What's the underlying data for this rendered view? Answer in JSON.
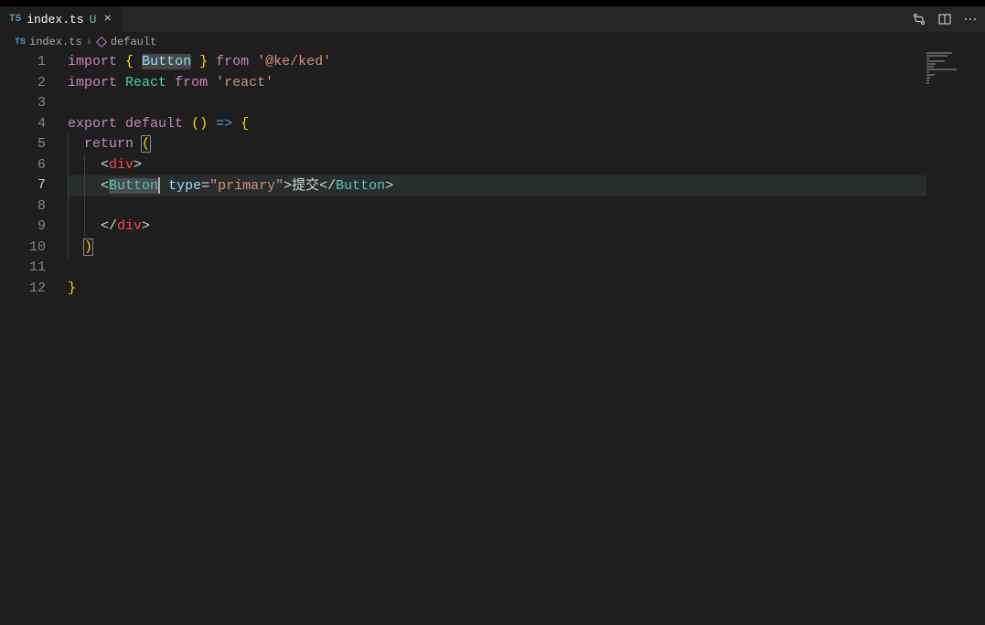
{
  "tab": {
    "filename": "index.ts",
    "status": "U",
    "icon": "TS"
  },
  "breadcrumb": {
    "file_icon": "TS",
    "file": "index.ts",
    "symbol": "default"
  },
  "line_numbers": [
    "1",
    "2",
    "3",
    "4",
    "5",
    "6",
    "7",
    "8",
    "9",
    "10",
    "11",
    "12"
  ],
  "active_line": 7,
  "code": {
    "l1": {
      "import": "import",
      "lbrace": "{",
      "button": "Button",
      "rbrace": "}",
      "from": "from",
      "pkg": "'@ke/ked'"
    },
    "l2": {
      "import": "import",
      "react": "React",
      "from": "from",
      "pkg": "'react'"
    },
    "l4": {
      "export": "export",
      "default": "default",
      "parens": "()",
      "arrow": "=>",
      "lbrace": "{"
    },
    "l5": {
      "return": "return",
      "lparen": "("
    },
    "l6": {
      "lt": "<",
      "div": "div",
      "gt": ">"
    },
    "l7": {
      "lt": "<",
      "button": "Button",
      "space": " ",
      "attr": "type",
      "eq": "=",
      "val": "\"primary\"",
      "gt": ">",
      "text": "提交",
      "lt2": "</",
      "button2": "Button",
      "gt2": ">"
    },
    "l9": {
      "lt": "</",
      "div": "div",
      "gt": ">"
    },
    "l10": {
      "rparen": ")"
    },
    "l12": {
      "rbrace": "}"
    }
  }
}
